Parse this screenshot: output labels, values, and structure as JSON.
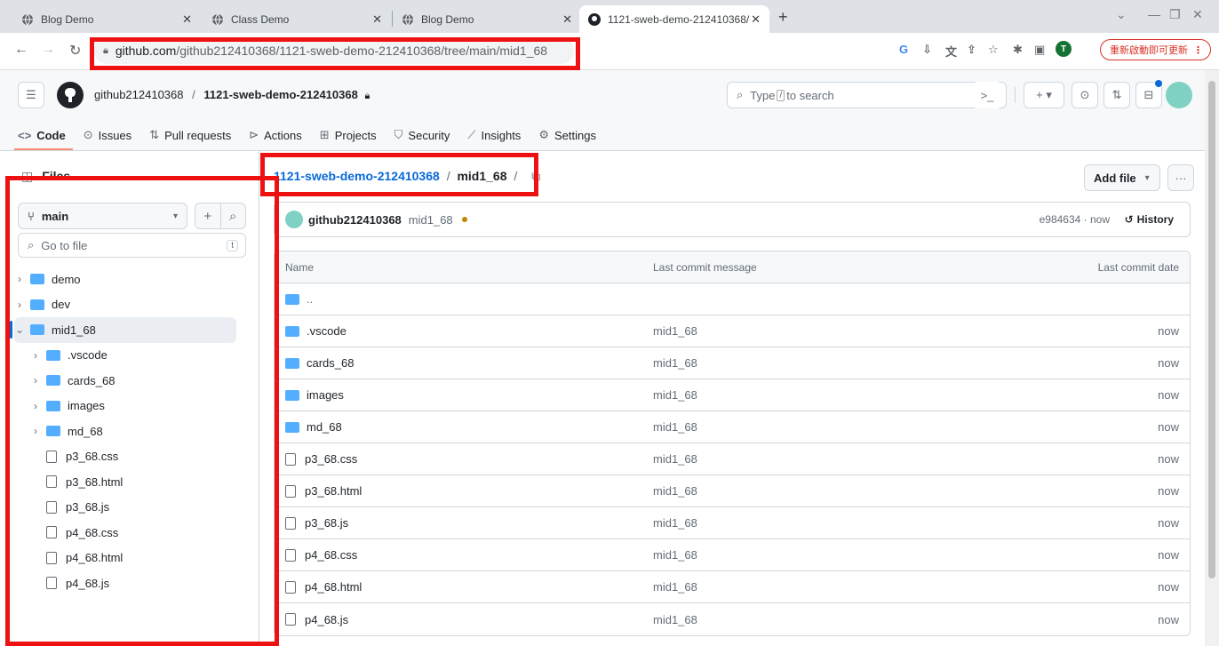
{
  "browser": {
    "tabs": [
      {
        "title": "Blog Demo",
        "active": false
      },
      {
        "title": "Class Demo",
        "active": false
      },
      {
        "title": "Blog Demo",
        "active": false
      },
      {
        "title": "1121-sweb-demo-212410368/",
        "active": true
      }
    ],
    "url_host": "github.com",
    "url_path": "/github212410368/1121-sweb-demo-212410368/tree/main/mid1_68",
    "update_label": "重新啟動即可更新",
    "profile_initial": "T"
  },
  "header": {
    "owner": "github212410368",
    "separator": "/",
    "repo": "1121-sweb-demo-212410368",
    "search_prefix": "Type",
    "search_key": "/",
    "search_suffix": "to search"
  },
  "repo_nav": [
    {
      "label": "Code",
      "icon": "code-icon",
      "selected": true
    },
    {
      "label": "Issues",
      "icon": "issue-icon"
    },
    {
      "label": "Pull requests",
      "icon": "pull-request-icon"
    },
    {
      "label": "Actions",
      "icon": "play-icon"
    },
    {
      "label": "Projects",
      "icon": "table-icon"
    },
    {
      "label": "Security",
      "icon": "shield-icon"
    },
    {
      "label": "Insights",
      "icon": "graph-icon"
    },
    {
      "label": "Settings",
      "icon": "gear-icon"
    }
  ],
  "sidebar": {
    "title": "Files",
    "branch": "main",
    "goto_placeholder": "Go to file",
    "goto_key": "t",
    "tree": [
      {
        "name": "demo",
        "type": "folder",
        "depth": 0,
        "expanded": false
      },
      {
        "name": "dev",
        "type": "folder",
        "depth": 0,
        "expanded": false
      },
      {
        "name": "mid1_68",
        "type": "folder",
        "depth": 0,
        "expanded": true,
        "selected": true
      },
      {
        "name": ".vscode",
        "type": "folder",
        "depth": 1,
        "expanded": false
      },
      {
        "name": "cards_68",
        "type": "folder",
        "depth": 1,
        "expanded": false
      },
      {
        "name": "images",
        "type": "folder",
        "depth": 1,
        "expanded": false
      },
      {
        "name": "md_68",
        "type": "folder",
        "depth": 1,
        "expanded": false
      },
      {
        "name": "p3_68.css",
        "type": "file",
        "depth": 1
      },
      {
        "name": "p3_68.html",
        "type": "file",
        "depth": 1
      },
      {
        "name": "p3_68.js",
        "type": "file",
        "depth": 1
      },
      {
        "name": "p4_68.css",
        "type": "file",
        "depth": 1
      },
      {
        "name": "p4_68.html",
        "type": "file",
        "depth": 1
      },
      {
        "name": "p4_68.js",
        "type": "file",
        "depth": 1
      }
    ]
  },
  "main": {
    "path_repo": "1121-sweb-demo-212410368",
    "path_sep": "/",
    "path_folder": "mid1_68",
    "path_trail": "/",
    "add_file_label": "Add file",
    "commit": {
      "author": "github212410368",
      "message": "mid1_68",
      "hash_time": "e984634 · now",
      "history_label": "History"
    },
    "columns": [
      "Name",
      "Last commit message",
      "Last commit date"
    ],
    "rows": [
      {
        "name": "..",
        "type": "folder",
        "message": "",
        "date": ""
      },
      {
        "name": ".vscode",
        "type": "folder",
        "message": "mid1_68",
        "date": "now"
      },
      {
        "name": "cards_68",
        "type": "folder",
        "message": "mid1_68",
        "date": "now"
      },
      {
        "name": "images",
        "type": "folder",
        "message": "mid1_68",
        "date": "now"
      },
      {
        "name": "md_68",
        "type": "folder",
        "message": "mid1_68",
        "date": "now"
      },
      {
        "name": "p3_68.css",
        "type": "file",
        "message": "mid1_68",
        "date": "now"
      },
      {
        "name": "p3_68.html",
        "type": "file",
        "message": "mid1_68",
        "date": "now"
      },
      {
        "name": "p3_68.js",
        "type": "file",
        "message": "mid1_68",
        "date": "now"
      },
      {
        "name": "p4_68.css",
        "type": "file",
        "message": "mid1_68",
        "date": "now"
      },
      {
        "name": "p4_68.html",
        "type": "file",
        "message": "mid1_68",
        "date": "now"
      },
      {
        "name": "p4_68.js",
        "type": "file",
        "message": "mid1_68",
        "date": "now"
      }
    ]
  },
  "colors": {
    "accent": "#0969da",
    "highlight": "#e11111",
    "folder": "#54aeff"
  }
}
